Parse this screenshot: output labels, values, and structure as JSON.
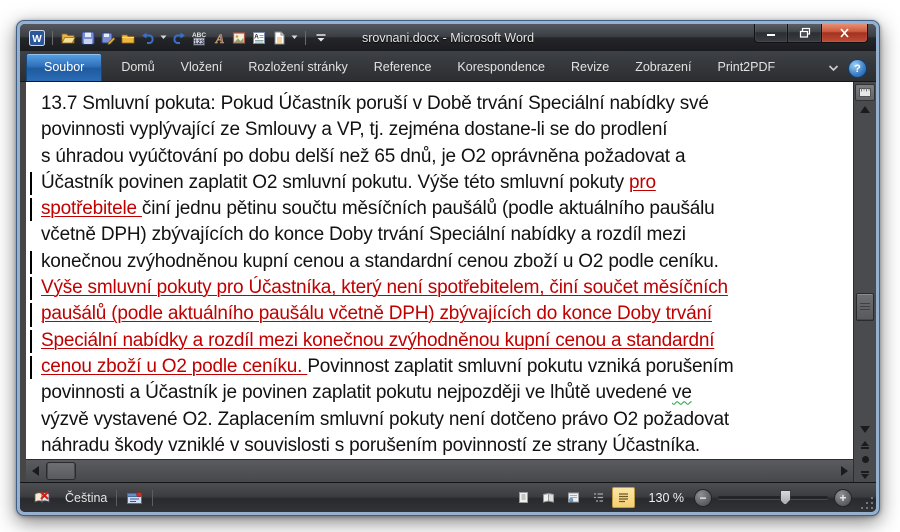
{
  "window": {
    "title": "srovnani.docx - Microsoft Word",
    "controls": [
      {
        "name": "minimize-button"
      },
      {
        "name": "maximize-button"
      },
      {
        "name": "close-button"
      }
    ]
  },
  "titlebar": {
    "qat_items": [
      {
        "name": "word-app-icon"
      },
      {
        "name": "separator"
      },
      {
        "name": "open-icon"
      },
      {
        "name": "save-icon"
      },
      {
        "name": "save-as-icon"
      },
      {
        "name": "new-folder-icon"
      },
      {
        "name": "undo-icon",
        "dropdown": true
      },
      {
        "name": "redo-icon"
      },
      {
        "name": "spelling-number-icon"
      },
      {
        "name": "translate-icon"
      },
      {
        "name": "picture-icon"
      },
      {
        "name": "autotext-icon"
      },
      {
        "name": "new-document-icon",
        "dropdown": true
      },
      {
        "name": "separator"
      },
      {
        "name": "qat-customize-icon"
      }
    ]
  },
  "ribbon": {
    "tabs": [
      {
        "label": "Soubor",
        "active": true
      },
      {
        "label": "Domů"
      },
      {
        "label": "Vložení"
      },
      {
        "label": "Rozložení stránky"
      },
      {
        "label": "Reference"
      },
      {
        "label": "Korespondence"
      },
      {
        "label": "Revize"
      },
      {
        "label": "Zobrazení"
      },
      {
        "label": "Print2PDF"
      }
    ],
    "right_icons": [
      "minimize-ribbon-chevron-icon",
      "help-icon"
    ],
    "help_glyph": "?"
  },
  "document": {
    "lines": [
      {
        "bar": false,
        "segments": [
          {
            "style": "normal",
            "text": "13.7 Smluvní pokuta: Pokud Účastník poruší v Době trvání Speciální nabídky své"
          }
        ]
      },
      {
        "bar": false,
        "segments": [
          {
            "style": "normal",
            "text": "povinnosti vyplývající ze Smlouvy a VP, tj. zejména dostane-li se do prodlení"
          }
        ]
      },
      {
        "bar": false,
        "segments": [
          {
            "style": "normal",
            "text": "s úhradou vyúčtování po dobu delší než 65 dnů, je O2 oprávněna požadovat a"
          }
        ]
      },
      {
        "bar": true,
        "segments": [
          {
            "style": "normal",
            "text": "Účastník povinen zaplatit O2 smluvní pokutu. Výše této smluvní pokuty "
          },
          {
            "style": "ins",
            "text": "pro"
          }
        ]
      },
      {
        "bar": true,
        "segments": [
          {
            "style": "ins",
            "text": "spotřebitele "
          },
          {
            "style": "normal",
            "text": "činí jednu pětinu součtu měsíčních paušálů (podle aktuálního paušálu"
          }
        ]
      },
      {
        "bar": false,
        "segments": [
          {
            "style": "normal",
            "text": "včetně DPH) zbývajících do konce Doby trvání Speciální nabídky a rozdíl mezi"
          }
        ]
      },
      {
        "bar": true,
        "segments": [
          {
            "style": "normal",
            "text": "konečnou zvýhodněnou kupní cenou a standardní cenou zboží u O2 podle ceníku."
          }
        ]
      },
      {
        "bar": true,
        "segments": [
          {
            "style": "ins",
            "text": "Výše smluvní pokuty pro Účastníka, který není spotřebitelem, činí součet měsíčních"
          }
        ]
      },
      {
        "bar": true,
        "segments": [
          {
            "style": "ins",
            "text": "paušálů (podle aktuálního paušálu včetně DPH) zbývajících do konce Doby trvání"
          }
        ]
      },
      {
        "bar": true,
        "segments": [
          {
            "style": "ins",
            "text": "Speciální nabídky a rozdíl mezi konečnou zvýhodněnou kupní cenou a standardní"
          }
        ]
      },
      {
        "bar": true,
        "segments": [
          {
            "style": "ins",
            "text": "cenou zboží u O2 podle ceníku. "
          },
          {
            "style": "normal",
            "text": "Povinnost zaplatit smluvní pokutu vzniká porušením"
          }
        ]
      },
      {
        "bar": false,
        "segments": [
          {
            "style": "normal",
            "text": "povinnosti a Účastník je povinen zaplatit pokutu nejpozději ve lhůtě uvedené "
          },
          {
            "style": "gram",
            "text": "ve"
          }
        ]
      },
      {
        "bar": false,
        "segments": [
          {
            "style": "normal",
            "text": "výzvě vystavené O2. Zaplacením smluvní pokuty není dotčeno právo O2 požadovat"
          }
        ]
      },
      {
        "bar": false,
        "segments": [
          {
            "style": "normal",
            "text": "náhradu škody vzniklé v souvislosti s porušením povinností ze strany Účastníka."
          }
        ]
      }
    ],
    "text_color": "#121212",
    "insertion_color": "#c00000",
    "grammar_underline_color": "#1aa03c"
  },
  "scrollbars": {
    "vertical": {
      "icons": [
        "view-ruler-icon",
        "scroll-up-icon",
        "scroll-down-icon",
        "previous-page-icon",
        "select-browse-object-icon",
        "next-page-icon"
      ],
      "thumb_position_pct": 58
    },
    "horizontal": {
      "icons": [
        "scroll-left-icon",
        "scroll-right-icon"
      ],
      "thumb_position_pct": 2
    }
  },
  "statusbar": {
    "left_icons": [
      "proofing-errors-icon",
      "track-changes-icon"
    ],
    "language": "Čeština",
    "view_buttons": [
      {
        "name": "print-layout-view"
      },
      {
        "name": "fullscreen-reading-view"
      },
      {
        "name": "web-layout-view"
      },
      {
        "name": "outline-view"
      },
      {
        "name": "draft-view",
        "active": true
      }
    ],
    "zoom_label": "130 %",
    "zoom_minus": "−",
    "zoom_plus": "+",
    "zoom_slider_pct": 56
  },
  "colors": {
    "file_tab_blue": "#2b6db6",
    "draft_button_amber": "#f4cf73",
    "close_button_red": "#c14d35",
    "chrome_dark": "#2c2e31"
  }
}
